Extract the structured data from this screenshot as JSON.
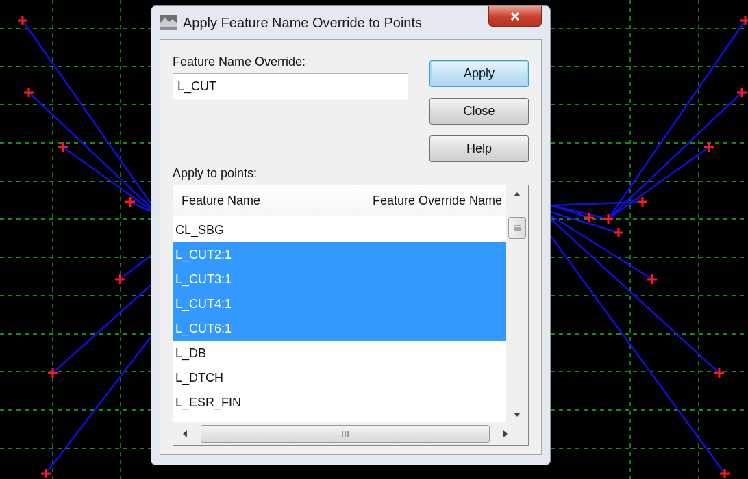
{
  "window": {
    "title": "Apply Feature Name Override to Points"
  },
  "override_field": {
    "label": "Feature Name Override:",
    "value": "L_CUT"
  },
  "buttons": [
    {
      "label": "Apply",
      "default": true
    },
    {
      "label": "Close",
      "default": false
    },
    {
      "label": "Help",
      "default": false
    }
  ],
  "points_list": {
    "label": "Apply to points:",
    "columns": [
      "Feature Name",
      "Feature Override Name"
    ],
    "rows": [
      {
        "name": "CL_SBG",
        "selected": false
      },
      {
        "name": "L_CUT2:1",
        "selected": true
      },
      {
        "name": "L_CUT3:1",
        "selected": true
      },
      {
        "name": "L_CUT4:1",
        "selected": true
      },
      {
        "name": "L_CUT6:1",
        "selected": true
      },
      {
        "name": "L_DB",
        "selected": false
      },
      {
        "name": "L_DTCH",
        "selected": false
      },
      {
        "name": "L_ESR_FIN",
        "selected": false
      }
    ]
  }
}
